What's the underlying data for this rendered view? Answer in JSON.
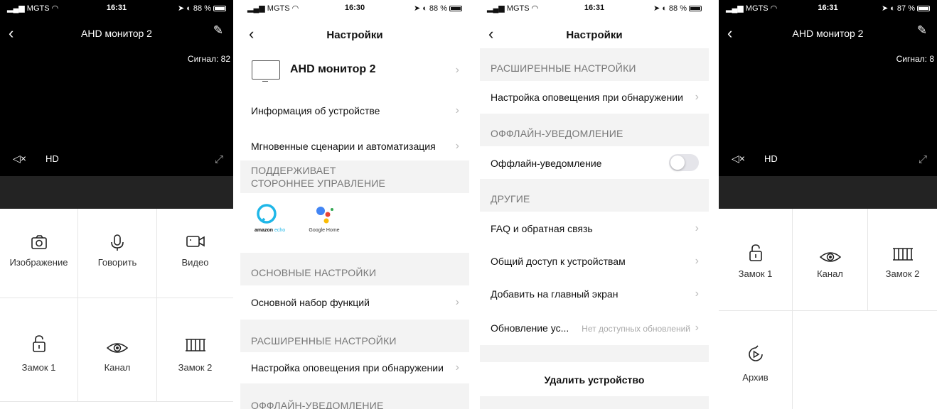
{
  "screens": [
    {
      "status": {
        "carrier": "MGTS",
        "time": "16:31",
        "battery": "88 %"
      },
      "header": {
        "title": "AHD монитор 2"
      },
      "video": {
        "signal": "Сигнал: 82",
        "quality": "HD"
      },
      "grid": [
        {
          "label": "Изображение",
          "icon": "camera-icon"
        },
        {
          "label": "Говорить",
          "icon": "microphone-icon"
        },
        {
          "label": "Видео",
          "icon": "video-icon"
        },
        {
          "label": "Замок 1",
          "icon": "lock-icon"
        },
        {
          "label": "Канал",
          "icon": "eye-icon"
        },
        {
          "label": "Замок 2",
          "icon": "gate-icon"
        }
      ]
    },
    {
      "status": {
        "carrier": "MGTS",
        "time": "16:30",
        "battery": "88 %"
      },
      "header": {
        "title": "Настройки"
      },
      "device_name": "AHD монитор 2",
      "rows": [
        "Информация об устройстве",
        "Мгновенные сценарии и автоматизация"
      ],
      "third_party_title_1": "ПОДДЕРЖИВАЕТ",
      "third_party_title_2": "СТОРОННЕЕ УПРАВЛЕНИЕ",
      "integrations": {
        "alexa_brand": "amazon",
        "alexa_product": "echo",
        "google": "Google Home"
      },
      "basic_section": "ОСНОВНЫЕ НАСТРОЙКИ",
      "basic_row": "Основной набор функций",
      "advanced_section": "РАСШИРЕННЫЕ НАСТРОЙКИ",
      "advanced_row": "Настройка оповещения при обнаружении",
      "offline_section": "ОФФЛАЙН-УВЕДОМЛЕНИЕ"
    },
    {
      "status": {
        "carrier": "MGTS",
        "time": "16:31",
        "battery": "88 %"
      },
      "header": {
        "title": "Настройки"
      },
      "advanced_section": "РАСШИРЕННЫЕ НАСТРОЙКИ",
      "advanced_row": "Настройка оповещения при обнаружении",
      "offline_section": "ОФФЛАЙН-УВЕДОМЛЕНИЕ",
      "offline_row": "Оффлайн-уведомление",
      "offline_enabled": false,
      "other_section": "ДРУГИЕ",
      "other_rows": [
        "FAQ и обратная связь",
        "Общий доступ к устройствам",
        "Добавить на главный экран"
      ],
      "update_row": "Обновление ус...",
      "update_status": "Нет доступных обновлений",
      "delete_button": "Удалить устройство"
    },
    {
      "status": {
        "carrier": "MGTS",
        "time": "16:31",
        "battery": "87 %"
      },
      "header": {
        "title": "AHD монитор 2"
      },
      "video": {
        "signal": "Сигнал: 8",
        "quality": "HD"
      },
      "grid": [
        {
          "label": "Замок 1",
          "icon": "lock-icon"
        },
        {
          "label": "Канал",
          "icon": "eye-icon"
        },
        {
          "label": "Замок 2",
          "icon": "gate-icon"
        },
        {
          "label": "Архив",
          "icon": "playback-icon"
        }
      ]
    }
  ]
}
